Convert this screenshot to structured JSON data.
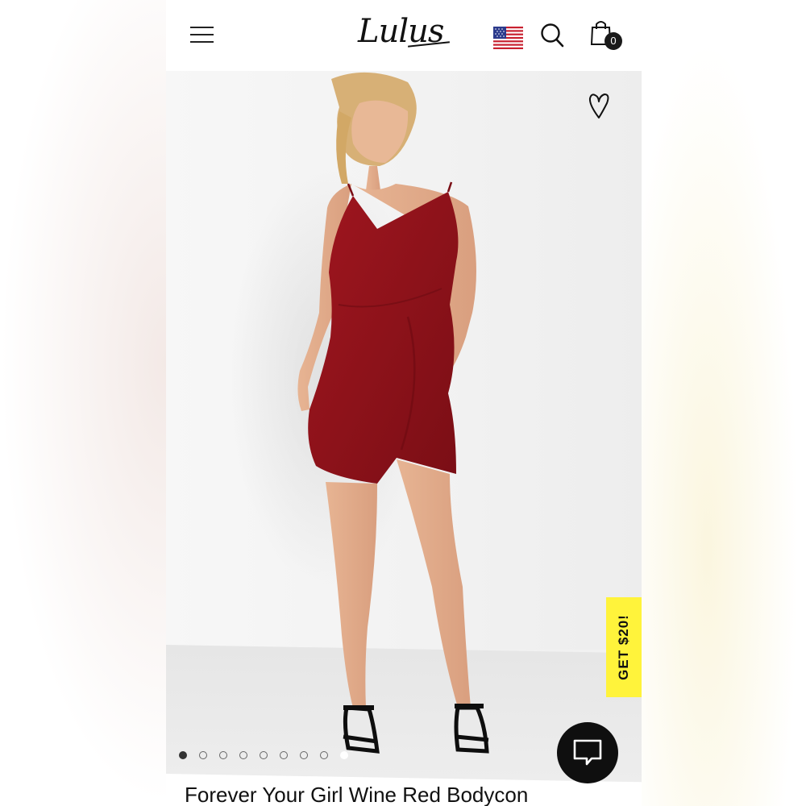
{
  "header": {
    "logo": "Lulus",
    "menu_icon": "hamburger-menu-icon",
    "flag_icon": "us-flag-icon",
    "search_icon": "search-icon",
    "bag_icon": "shopping-bag-icon",
    "bag_count": "0"
  },
  "gallery": {
    "favorite_icon": "heart-icon",
    "dot_count": 9,
    "active_index": 0
  },
  "promo": {
    "label": "GET $20!",
    "color": "#fff33b"
  },
  "chat": {
    "icon": "chat-bubble-icon"
  },
  "product": {
    "title": "Forever Your Girl Wine Red Bodycon",
    "dress_color": "#8e1219"
  }
}
